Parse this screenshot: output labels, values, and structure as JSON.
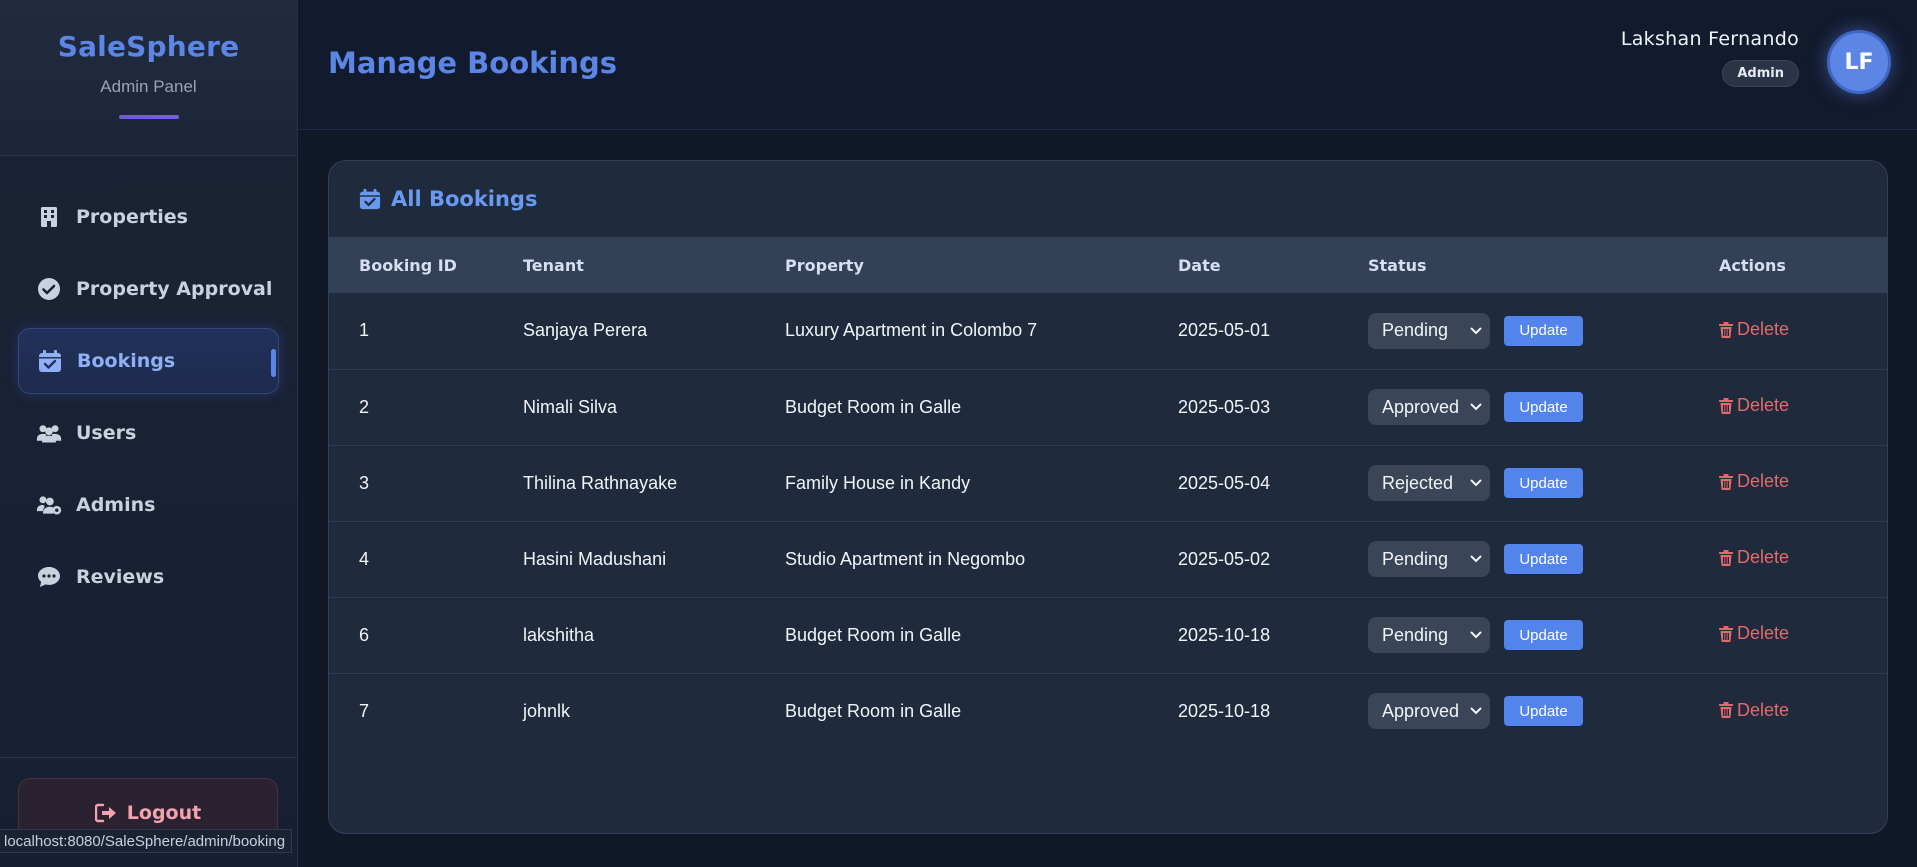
{
  "brand": {
    "title": "SaleSphere",
    "subtitle": "Admin Panel"
  },
  "sidebar": {
    "items": [
      {
        "label": "Properties",
        "icon": "building-icon"
      },
      {
        "label": "Property Approval",
        "icon": "check-circle-icon"
      },
      {
        "label": "Bookings",
        "icon": "calendar-check-icon",
        "active": true
      },
      {
        "label": "Users",
        "icon": "users-icon"
      },
      {
        "label": "Admins",
        "icon": "users-gear-icon"
      },
      {
        "label": "Reviews",
        "icon": "comment-dots-icon"
      }
    ],
    "logout_label": "Logout"
  },
  "header": {
    "page_title": "Manage Bookings",
    "user_name": "Lakshan Fernando",
    "user_role": "Admin",
    "avatar_initials": "LF"
  },
  "card": {
    "title": "All Bookings",
    "columns": [
      "Booking ID",
      "Tenant",
      "Property",
      "Date",
      "Status",
      "Actions"
    ],
    "update_label": "Update",
    "delete_label": "Delete",
    "rows": [
      {
        "id": "1",
        "tenant": "Sanjaya Perera",
        "property": "Luxury Apartment in Colombo 7",
        "date": "2025-05-01",
        "status": "Pending"
      },
      {
        "id": "2",
        "tenant": "Nimali Silva",
        "property": "Budget Room in Galle",
        "date": "2025-05-03",
        "status": "Approved"
      },
      {
        "id": "3",
        "tenant": "Thilina Rathnayake",
        "property": "Family House in Kandy",
        "date": "2025-05-04",
        "status": "Rejected"
      },
      {
        "id": "4",
        "tenant": "Hasini Madushani",
        "property": "Studio Apartment in Negombo",
        "date": "2025-05-02",
        "status": "Pending"
      },
      {
        "id": "6",
        "tenant": "lakshitha",
        "property": "Budget Room in Galle",
        "date": "2025-10-18",
        "status": "Pending"
      },
      {
        "id": "7",
        "tenant": "johnlk",
        "property": "Budget Room in Galle",
        "date": "2025-10-18",
        "status": "Approved"
      }
    ]
  },
  "status_bar": {
    "url": "localhost:8080/SaleSphere/admin/booking"
  },
  "colors": {
    "accent": "#5b86e5",
    "danger": "#e06b6b",
    "background": "#111827",
    "card": "#1f2a3d"
  }
}
